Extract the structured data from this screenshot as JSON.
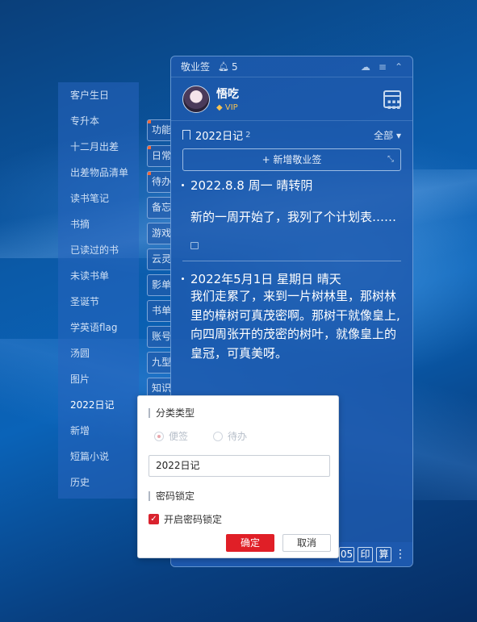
{
  "sidebar": {
    "items": [
      {
        "label": "客户生日"
      },
      {
        "label": "专升本"
      },
      {
        "label": "十二月出差"
      },
      {
        "label": "出差物品清单"
      },
      {
        "label": "读书笔记"
      },
      {
        "label": "书摘"
      },
      {
        "label": "已读过的书"
      },
      {
        "label": "未读书单"
      },
      {
        "label": "圣诞节"
      },
      {
        "label": "学英语flag"
      },
      {
        "label": "汤圆"
      },
      {
        "label": "图片"
      },
      {
        "label": "2022日记"
      },
      {
        "label": "新增"
      },
      {
        "label": "短篇小说"
      },
      {
        "label": "历史"
      }
    ],
    "active_index": 12
  },
  "tabs": [
    {
      "label": "功能"
    },
    {
      "label": "日常"
    },
    {
      "label": "待办"
    },
    {
      "label": "备忘"
    },
    {
      "label": "游戏"
    },
    {
      "label": "云灵"
    },
    {
      "label": "影单"
    },
    {
      "label": "书单"
    },
    {
      "label": "账号"
    },
    {
      "label": "九型"
    },
    {
      "label": "知识"
    }
  ],
  "panel": {
    "app_title": "敬业签",
    "bell_count": "5",
    "user": {
      "name": "悟吃",
      "vip": "VIP"
    },
    "section": {
      "title": "2022日记",
      "count": "2",
      "filter": "全部"
    },
    "add_button": "+ 新增敬业签",
    "notes": [
      {
        "date": "2022.8.8   周一     晴转阴",
        "body": "新的一周开始了，我列了个计划表……"
      },
      {
        "date": "2022年5月1日     星期日       晴天",
        "body": "我们走累了，来到一片树林里，那树林里的樟树可真茂密啊。那树干就像皇上,向四周张开的茂密的树叶，就像皇上的皇冠，可真美呀。"
      }
    ],
    "bottom_buttons": [
      "05",
      "印",
      "算"
    ]
  },
  "dialog": {
    "category_type_label": "分类类型",
    "radio_note": "便签",
    "radio_todo": "待办",
    "name_value": "2022日记",
    "password_lock_label": "密码锁定",
    "enable_lock_label": "开启密码锁定",
    "confirm": "确定",
    "cancel": "取消"
  },
  "colors": {
    "accent_red": "#e01f27",
    "panel_blue": "#1e5aaf",
    "vip_gold": "#f4c253"
  }
}
